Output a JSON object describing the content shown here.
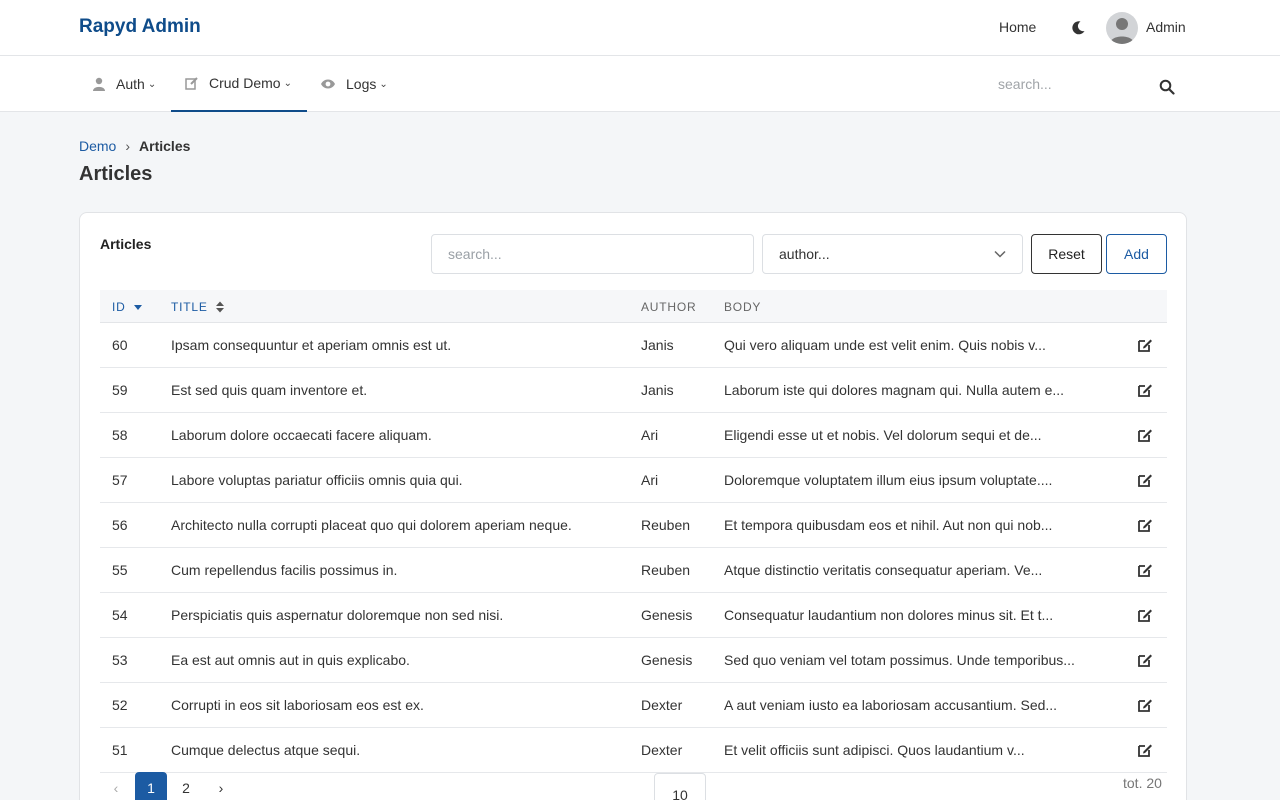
{
  "header": {
    "brand": "Rapyd Admin",
    "home": "Home",
    "user": "Admin"
  },
  "nav": {
    "items": [
      {
        "label": "Auth",
        "icon": "user-icon"
      },
      {
        "label": "Crud Demo",
        "icon": "edit-icon"
      },
      {
        "label": "Logs",
        "icon": "eye-icon"
      }
    ],
    "search_placeholder": "search..."
  },
  "breadcrumb": {
    "parent": "Demo",
    "separator": "›",
    "current": "Articles"
  },
  "page_title": "Articles",
  "card": {
    "title": "Articles",
    "search_placeholder": "search...",
    "author_placeholder": "author...",
    "reset": "Reset",
    "add": "Add"
  },
  "table": {
    "columns": [
      "ID",
      "TITLE",
      "AUTHOR",
      "BODY"
    ],
    "rows": [
      {
        "id": "60",
        "title": "Ipsam consequuntur et aperiam omnis est ut.",
        "author": "Janis",
        "body": "Qui vero aliquam unde est velit enim. Quis nobis v..."
      },
      {
        "id": "59",
        "title": "Est sed quis quam inventore et.",
        "author": "Janis",
        "body": "Laborum iste qui dolores magnam qui. Nulla autem e..."
      },
      {
        "id": "58",
        "title": "Laborum dolore occaecati facere aliquam.",
        "author": "Ari",
        "body": "Eligendi esse ut et nobis. Vel dolorum sequi et de..."
      },
      {
        "id": "57",
        "title": "Labore voluptas pariatur officiis omnis quia qui.",
        "author": "Ari",
        "body": "Doloremque voluptatem illum eius ipsum voluptate...."
      },
      {
        "id": "56",
        "title": "Architecto nulla corrupti placeat quo qui dolorem aperiam neque.",
        "author": "Reuben",
        "body": "Et tempora quibusdam eos et nihil. Aut non qui nob..."
      },
      {
        "id": "55",
        "title": "Cum repellendus facilis possimus in.",
        "author": "Reuben",
        "body": "Atque distinctio veritatis consequatur aperiam. Ve..."
      },
      {
        "id": "54",
        "title": "Perspiciatis quis aspernatur doloremque non sed nisi.",
        "author": "Genesis",
        "body": "Consequatur laudantium non dolores minus sit. Et t..."
      },
      {
        "id": "53",
        "title": "Ea est aut omnis aut in quis explicabo.",
        "author": "Genesis",
        "body": "Sed quo veniam vel totam possimus. Unde temporibus..."
      },
      {
        "id": "52",
        "title": "Corrupti in eos sit laboriosam eos est ex.",
        "author": "Dexter",
        "body": "A aut veniam iusto ea laboriosam accusantium. Sed..."
      },
      {
        "id": "51",
        "title": "Cumque delectus atque sequi.",
        "author": "Dexter",
        "body": "Et velit officiis sunt adipisci. Quos laudantium v..."
      }
    ]
  },
  "pagination": {
    "prev": "‹",
    "pages": [
      "1",
      "2"
    ],
    "next": "›",
    "current": "1",
    "per_page": "10",
    "total": "tot. 20"
  },
  "colors": {
    "brand": "#0f4c8a",
    "link": "#1c5ba3",
    "background": "#f4f6f8"
  }
}
